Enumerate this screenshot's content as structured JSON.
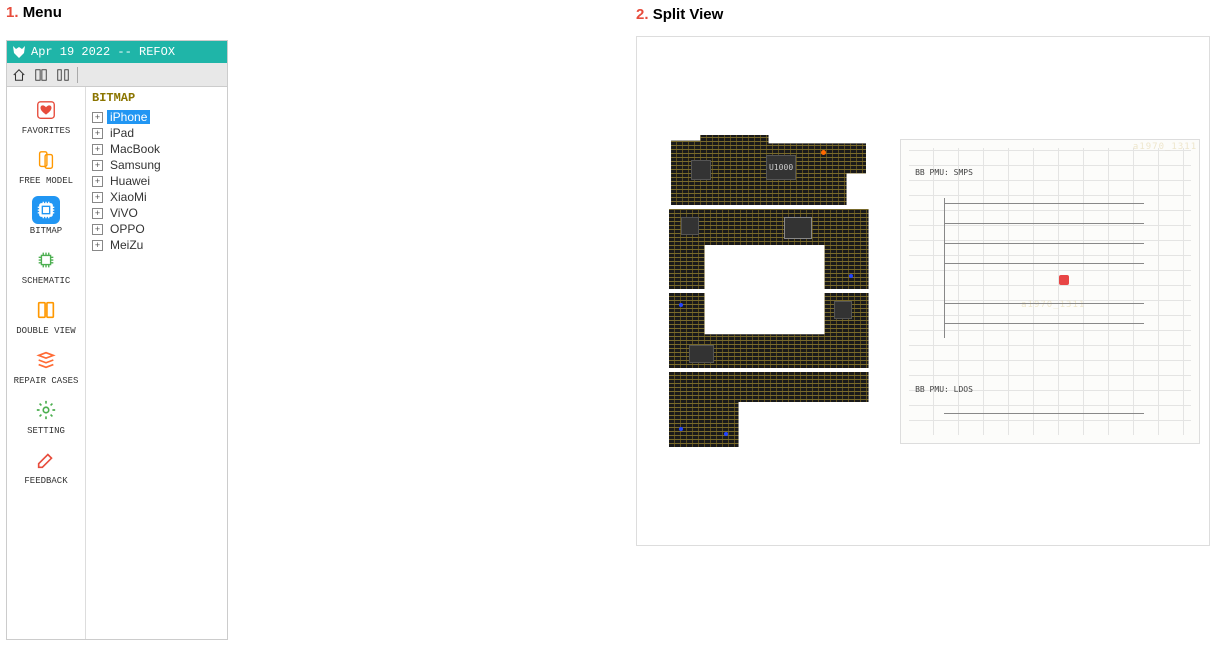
{
  "sections": {
    "menu": {
      "num": "1.",
      "label": "Menu"
    },
    "split": {
      "num": "2.",
      "label": "Split View"
    }
  },
  "titlebar": "Apr 19 2022 -- REFOX",
  "sidebar": [
    {
      "label": "FAVORITES",
      "icon": "heart",
      "color": "#e74c3c"
    },
    {
      "label": "FREE MODEL",
      "icon": "phones",
      "color": "#ff9800"
    },
    {
      "label": "BITMAP",
      "icon": "chip",
      "color": "#2196F3",
      "active": true
    },
    {
      "label": "SCHEMATIC",
      "icon": "cpu",
      "color": "#4CAF50"
    },
    {
      "label": "DOUBLE VIEW",
      "icon": "columns",
      "color": "#ff9800"
    },
    {
      "label": "REPAIR CASES",
      "icon": "layers",
      "color": "#ff6b35"
    },
    {
      "label": "SETTING",
      "icon": "gear",
      "color": "#4CAF50"
    },
    {
      "label": "FEEDBACK",
      "icon": "pencil",
      "color": "#e74c3c"
    }
  ],
  "tree": {
    "header": "BITMAP",
    "items": [
      {
        "label": "iPhone",
        "selected": true
      },
      {
        "label": "iPad"
      },
      {
        "label": "MacBook"
      },
      {
        "label": "Samsung"
      },
      {
        "label": "Huawei"
      },
      {
        "label": "XiaoMi"
      },
      {
        "label": "ViVO"
      },
      {
        "label": "OPPO"
      },
      {
        "label": "MeiZu"
      }
    ]
  },
  "pcb": {
    "chip_label": "U1000"
  },
  "schematic": {
    "title1": "BB PMU: SMPS",
    "title2": "BB PMU: LDOS",
    "watermark": "a1970_1311"
  }
}
